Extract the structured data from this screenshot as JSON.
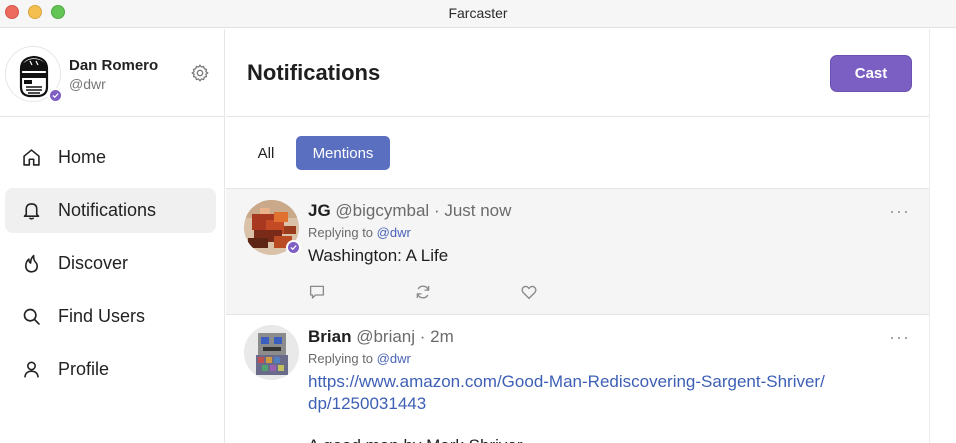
{
  "window": {
    "title": "Farcaster"
  },
  "profile": {
    "name": "Dan Romero",
    "handle": "@dwr"
  },
  "nav": {
    "items": [
      {
        "label": "Home",
        "icon": "home-icon"
      },
      {
        "label": "Notifications",
        "icon": "bell-icon",
        "active": true
      },
      {
        "label": "Discover",
        "icon": "flame-icon"
      },
      {
        "label": "Find Users",
        "icon": "search-icon"
      },
      {
        "label": "Profile",
        "icon": "user-icon"
      }
    ]
  },
  "header": {
    "title": "Notifications",
    "cast_button": "Cast"
  },
  "filters": {
    "all": "All",
    "mentions": "Mentions",
    "selected": "Mentions"
  },
  "casts": [
    {
      "name": "JG",
      "handle": "@bigcymbal",
      "sep": " · ",
      "time": "Just now",
      "replying_prefix": "Replying to",
      "replying_to": "@dwr",
      "text": "Washington: A Life",
      "more": "···"
    },
    {
      "name": "Brian",
      "handle": "@brianj",
      "sep": " · ",
      "time": "2m",
      "replying_prefix": "Replying to",
      "replying_to": "@dwr",
      "link": "https://www.amazon.com/Good-Man-Rediscovering-Sargent-Shriver/dp/1250031443",
      "text": "A good man by Mark Shriver",
      "more": "···"
    }
  ],
  "colors": {
    "accent": "#7b5fc3",
    "mentions_tab": "#5a6fbf",
    "link": "#3d5fb5",
    "verified_badge": "#7e5fc4"
  }
}
